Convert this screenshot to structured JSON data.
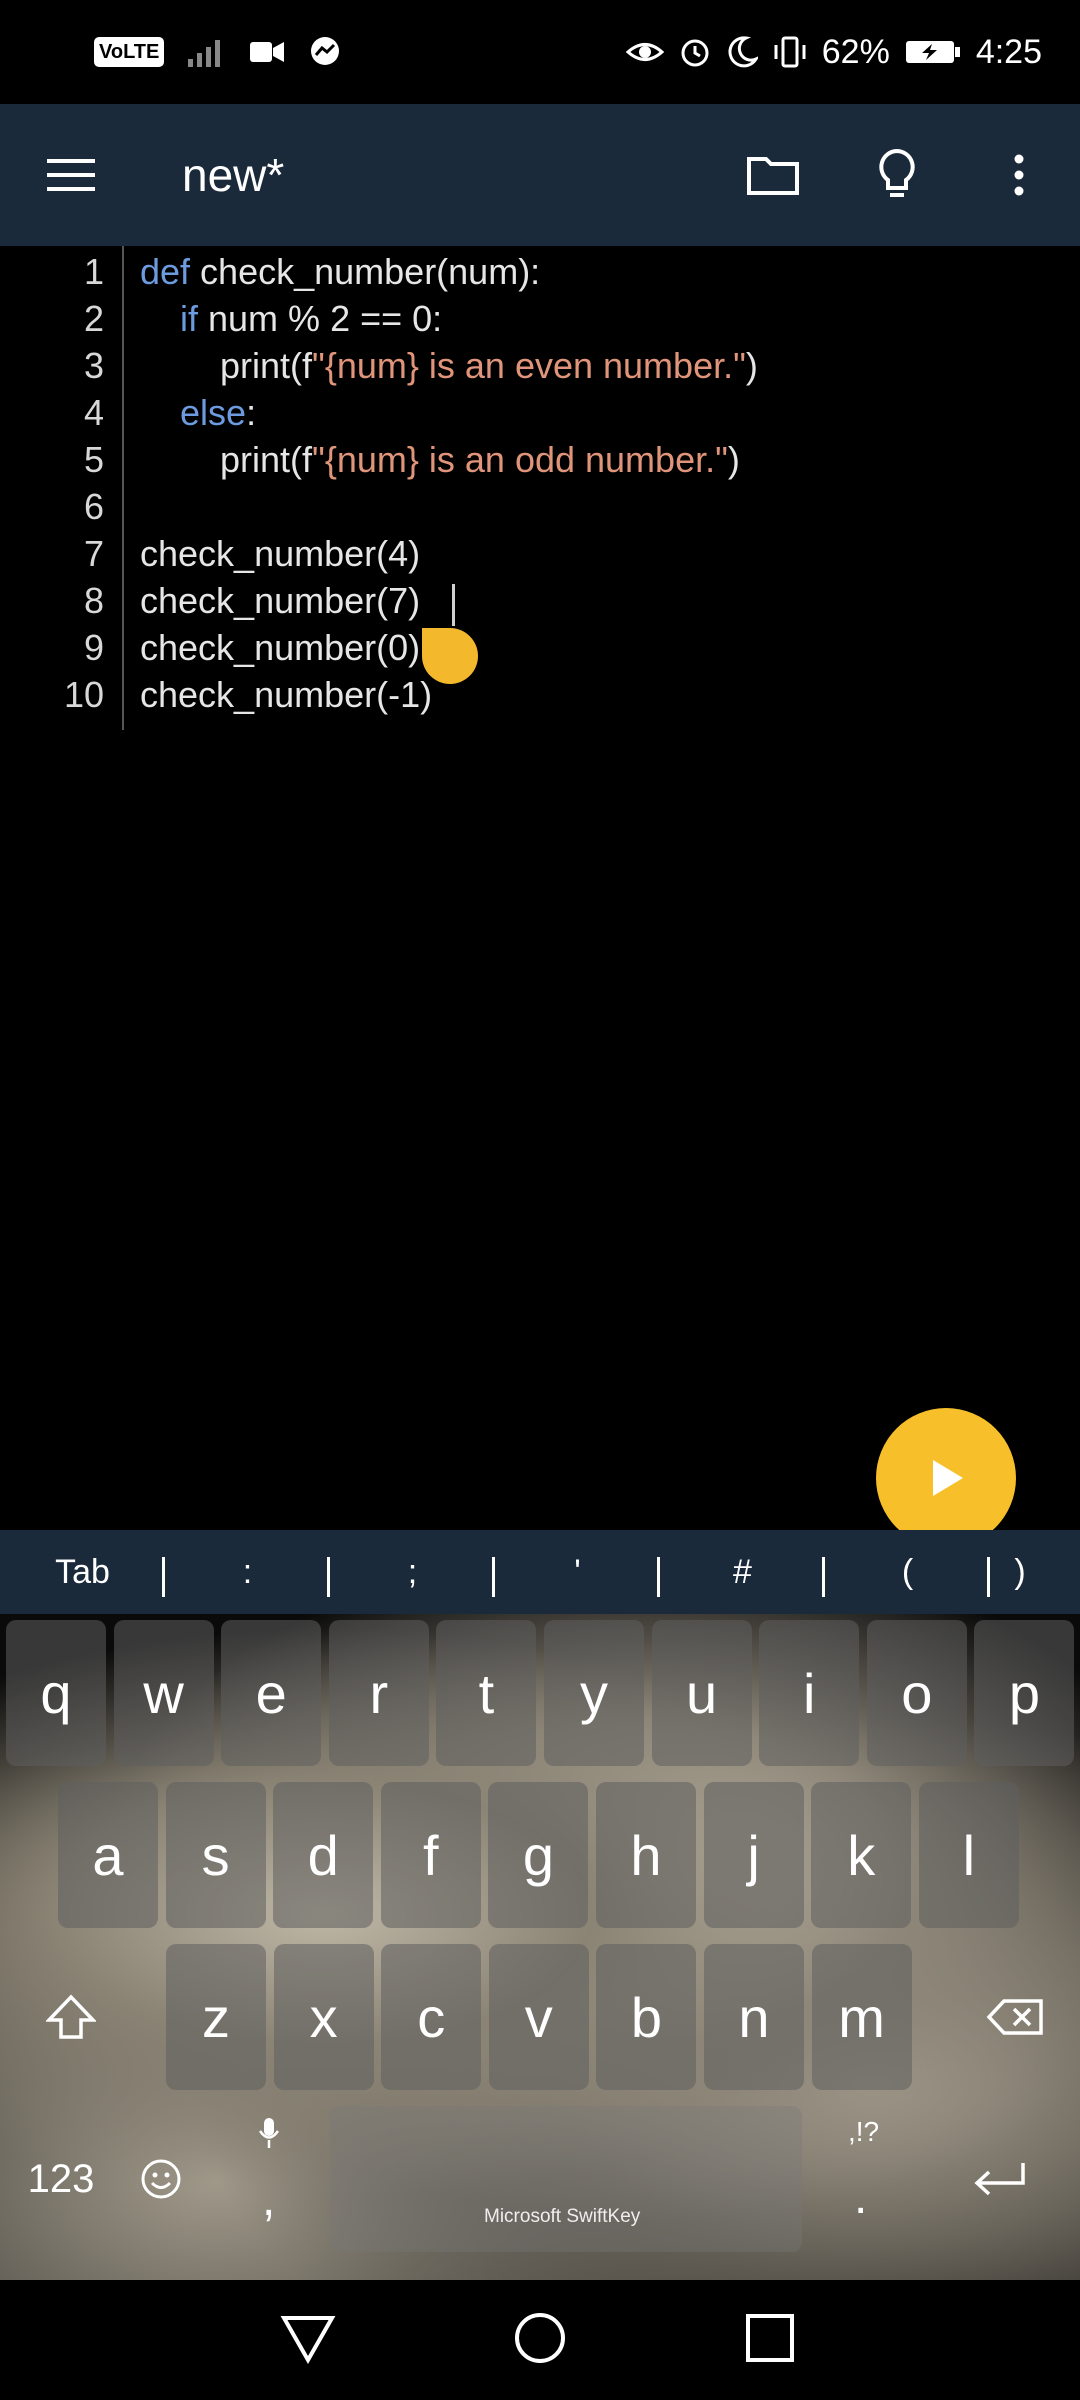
{
  "status_bar": {
    "volte": "VoLTE",
    "battery": "62%",
    "time": "4:25"
  },
  "app_bar": {
    "title": "new*",
    "icons": [
      "menu-icon",
      "folder-icon",
      "lightbulb-icon",
      "more-vert-icon"
    ]
  },
  "editor": {
    "lines": [
      {
        "num": "1",
        "parts": [
          {
            "t": "def",
            "c": "kw"
          },
          {
            "t": " check_number(num):",
            "c": ""
          }
        ]
      },
      {
        "num": "2",
        "parts": [
          {
            "t": "    ",
            "c": ""
          },
          {
            "t": "if",
            "c": "kw"
          },
          {
            "t": " num % 2 == 0:",
            "c": ""
          }
        ]
      },
      {
        "num": "3",
        "parts": [
          {
            "t": "        print(f",
            "c": ""
          },
          {
            "t": "\"{num} is an even number.\"",
            "c": "str"
          },
          {
            "t": ")",
            "c": ""
          }
        ]
      },
      {
        "num": "4",
        "parts": [
          {
            "t": "    ",
            "c": ""
          },
          {
            "t": "else",
            "c": "kw"
          },
          {
            "t": ":",
            "c": ""
          }
        ]
      },
      {
        "num": "5",
        "parts": [
          {
            "t": "        print(f",
            "c": ""
          },
          {
            "t": "\"{num} is an odd number.\"",
            "c": "str"
          },
          {
            "t": ")",
            "c": ""
          }
        ]
      },
      {
        "num": "6",
        "parts": []
      },
      {
        "num": "7",
        "parts": [
          {
            "t": "check_number(4)",
            "c": ""
          }
        ]
      },
      {
        "num": "8",
        "parts": [
          {
            "t": "check_number(7)",
            "c": ""
          }
        ]
      },
      {
        "num": "9",
        "parts": [
          {
            "t": "check_number(0)",
            "c": ""
          }
        ]
      },
      {
        "num": "10",
        "parts": [
          {
            "t": "check_number(-1)",
            "c": ""
          }
        ]
      }
    ]
  },
  "symbol_bar": [
    "Tab",
    ":",
    ";",
    "'",
    "#",
    "(",
    ")"
  ],
  "keyboard": {
    "row1": [
      "q",
      "w",
      "e",
      "r",
      "t",
      "y",
      "u",
      "i",
      "o",
      "p"
    ],
    "row2": [
      "a",
      "s",
      "d",
      "f",
      "g",
      "h",
      "j",
      "k",
      "l"
    ],
    "row3": [
      "z",
      "x",
      "c",
      "v",
      "b",
      "n",
      "m"
    ],
    "numbers_key": "123",
    "comma_key": ",",
    "period_key": ".",
    "punct_hint": ",!?",
    "brand": "Microsoft SwiftKey"
  },
  "colors": {
    "app_bar": "#1b2a3a",
    "accent": "#f7c02a",
    "keyword": "#6d9be0",
    "string": "#e0957a"
  }
}
